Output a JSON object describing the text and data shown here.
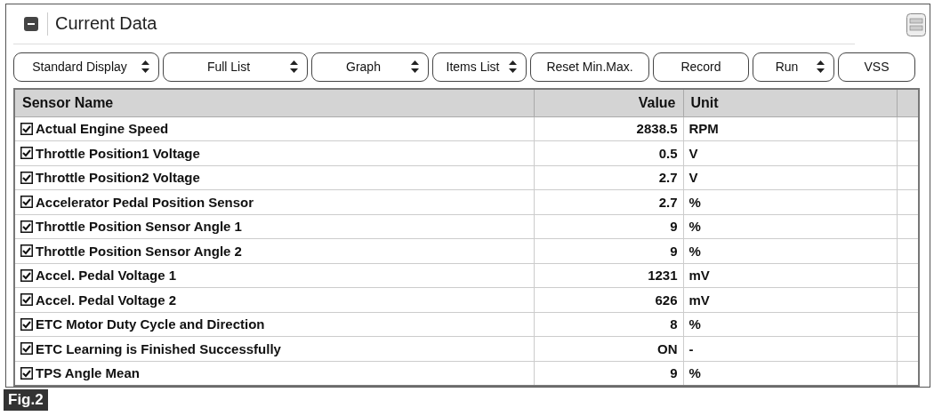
{
  "panel": {
    "title": "Current Data"
  },
  "toolbar": [
    {
      "label": "Standard Display",
      "kind": "dropdown"
    },
    {
      "label": "Full List",
      "kind": "dropdown"
    },
    {
      "label": "Graph",
      "kind": "dropdown"
    },
    {
      "label": "Items List",
      "kind": "dropdown"
    },
    {
      "label": "Reset Min.Max.",
      "kind": "button"
    },
    {
      "label": "Record",
      "kind": "button"
    },
    {
      "label": "Run",
      "kind": "dropdown"
    },
    {
      "label": "VSS",
      "kind": "button"
    }
  ],
  "table": {
    "columns": [
      "Sensor Name",
      "Value",
      "Unit"
    ],
    "rows": [
      {
        "name": "Actual Engine Speed",
        "value": "2838.5",
        "unit": "RPM",
        "checked": true
      },
      {
        "name": "Throttle Position1 Voltage",
        "value": "0.5",
        "unit": "V",
        "checked": true
      },
      {
        "name": "Throttle Position2 Voltage",
        "value": "2.7",
        "unit": "V",
        "checked": true
      },
      {
        "name": "Accelerator Pedal Position Sensor",
        "value": "2.7",
        "unit": "%",
        "checked": true
      },
      {
        "name": "Throttle Position Sensor Angle 1",
        "value": "9",
        "unit": "%",
        "checked": true
      },
      {
        "name": "Throttle Position Sensor Angle 2",
        "value": "9",
        "unit": "%",
        "checked": true
      },
      {
        "name": "Accel. Pedal Voltage 1",
        "value": "1231",
        "unit": "mV",
        "checked": true
      },
      {
        "name": "Accel. Pedal Voltage 2",
        "value": "626",
        "unit": "mV",
        "checked": true
      },
      {
        "name": "ETC Motor Duty Cycle and Direction",
        "value": "8",
        "unit": "%",
        "checked": true
      },
      {
        "name": "ETC Learning is Finished Successfully",
        "value": "ON",
        "unit": "-",
        "checked": true
      },
      {
        "name": "TPS Angle Mean",
        "value": "9",
        "unit": "%",
        "checked": true
      }
    ]
  },
  "figure_label": "Fig.2"
}
